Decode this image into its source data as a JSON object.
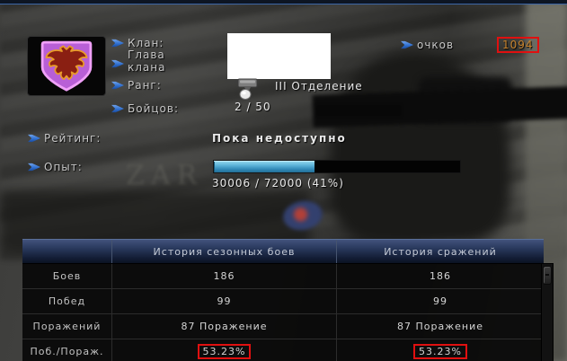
{
  "clan_info": {
    "labels": {
      "clan": "Клан:",
      "leader_line1": "Глава",
      "leader_line2": "клана",
      "rank": "Ранг:",
      "fighters": "Бойцов:",
      "points": "очков",
      "rating": "Рейтинг:",
      "experience": "Опыт:"
    },
    "values": {
      "rank": "III Отделение",
      "fighters": "2 / 50",
      "points": "1094",
      "rating": "Пока недоступно",
      "experience_text": "30006 / 72000 (41%)",
      "experience_percent": 41
    }
  },
  "history_table": {
    "columns": [
      "",
      "История сезонных боев",
      "История сражений"
    ],
    "rows": [
      {
        "label": "Боев",
        "seasonal": "186",
        "overall": "186",
        "highlighted": false
      },
      {
        "label": "Побед",
        "seasonal": "99",
        "overall": "99",
        "highlighted": false
      },
      {
        "label": "Поражений",
        "seasonal": "87 Поражение",
        "overall": "87 Поражение",
        "highlighted": false
      },
      {
        "label": "Поб./Пораж.",
        "seasonal": "53.23%",
        "overall": "53.23%",
        "highlighted": true
      }
    ]
  },
  "background": {
    "sign_text": "ZAR"
  },
  "colors": {
    "accent_blue": "#2f6fd0",
    "points_orange": "#c8832d",
    "annotation_red": "#e01010",
    "progress_cyan": "#4aa3cc",
    "header_navy": "#2a3a5e",
    "emblem_purple": "#b85fd6",
    "emblem_eagle_red": "#8a1f12",
    "emblem_eagle_gold": "#e89b28"
  }
}
